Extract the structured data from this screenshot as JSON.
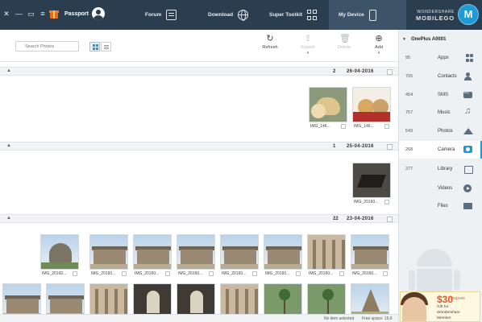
{
  "window": {
    "controls": [
      "✕",
      "—",
      "▭",
      "≡"
    ],
    "passport_label": "Passport"
  },
  "nav": {
    "tabs": [
      {
        "label": "Forum",
        "icon": "forum-icon"
      },
      {
        "label": "Download",
        "icon": "globe-icon"
      },
      {
        "label": "Super Toolkit",
        "icon": "grid-icon"
      },
      {
        "label": "My Device",
        "icon": "phone-icon"
      }
    ],
    "active_tab": "My Device"
  },
  "brand": {
    "line1": "WONDERSHARE",
    "line2": "MOBILEGO",
    "logo_letter": "M",
    "accent": "#1e9ad6"
  },
  "toolbar": {
    "search_placeholder": "Search Photos",
    "add_label": "Add",
    "delete_label": "Delete",
    "export_label": "Export",
    "refresh_label": "Refresh"
  },
  "sidebar": {
    "device_name": "OnePlus A0001",
    "items": [
      {
        "label": "Apps",
        "count": "95",
        "icon": "apps-icon"
      },
      {
        "label": "Contacts",
        "count": "705",
        "icon": "contacts-icon"
      },
      {
        "label": "SMS",
        "count": "454",
        "icon": "sms-icon"
      },
      {
        "label": "Music",
        "count": "757",
        "icon": "music-icon"
      },
      {
        "label": "Photos",
        "count": "543",
        "icon": "photos-icon"
      },
      {
        "label": "Camera",
        "count": "268",
        "icon": "camera-icon"
      },
      {
        "label": "Library",
        "count": "277",
        "icon": "library-icon"
      },
      {
        "label": "Videos",
        "count": "",
        "icon": "videos-icon"
      },
      {
        "label": "Files",
        "count": "",
        "icon": "files-icon"
      }
    ],
    "active_item": "Camera"
  },
  "groups": [
    {
      "date": "26-04-2016",
      "count": "2",
      "photos": [
        {
          "caption": "IMG_146...",
          "scene": "puppies"
        },
        {
          "caption": "IMG_146...",
          "scene": "dog"
        }
      ]
    },
    {
      "date": "25-04-2016",
      "count": "1",
      "photos": [
        {
          "caption": "IMG_20160...",
          "scene": "dark"
        }
      ]
    },
    {
      "date": "23-04-2016",
      "count": "22",
      "photos": [
        {
          "caption": "IMG_20160...",
          "scene": "temple"
        },
        {
          "caption": "IMG_20160...",
          "scene": "arches"
        },
        {
          "caption": "IMG_20160...",
          "scene": "temple"
        },
        {
          "caption": "IMG_20160...",
          "scene": "temple"
        },
        {
          "caption": "IMG_20160...",
          "scene": "temple"
        },
        {
          "caption": "IMG_20160...",
          "scene": "temple"
        },
        {
          "caption": "IMG_20160...",
          "scene": "temple"
        },
        {
          "caption": "IMG_20160...",
          "scene": "stupa"
        },
        {
          "caption": "",
          "scene": "gopuram"
        },
        {
          "caption": "",
          "scene": "palm"
        },
        {
          "caption": "",
          "scene": "palm"
        },
        {
          "caption": "",
          "scene": "arches"
        },
        {
          "caption": "",
          "scene": "hall"
        },
        {
          "caption": "",
          "scene": "hall"
        },
        {
          "caption": "",
          "scene": "arches"
        },
        {
          "caption": "",
          "scene": "temple"
        },
        {
          "caption": "",
          "scene": "temple"
        },
        {
          "caption": "",
          "scene": "stupa"
        }
      ]
    }
  ],
  "status": {
    "selection": "No item selected",
    "free_space": "Free space: 15.6"
  },
  "ad": {
    "price": "$30",
    "coupon": "coupons",
    "line1": "Gift for",
    "line2": "Wondershare",
    "line3": "Member"
  }
}
